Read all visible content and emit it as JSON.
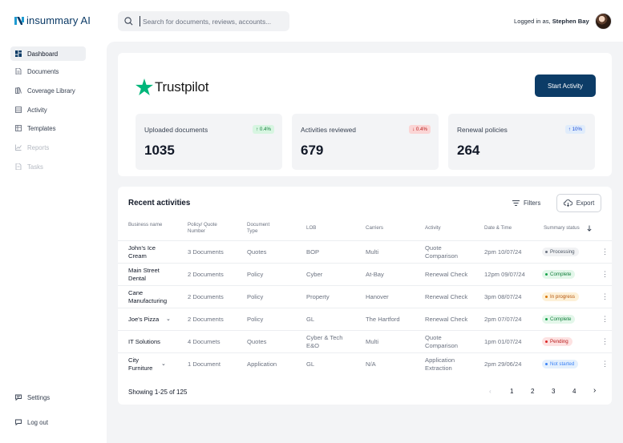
{
  "app": {
    "logo_text": "insummary AI"
  },
  "search": {
    "placeholder": "Search for documents, reviews, accounts..."
  },
  "user": {
    "prefix": "Logged in as,",
    "name": "Stephen Bay"
  },
  "sidebar": {
    "items": [
      {
        "label": "Dashboard",
        "icon": "dashboard-icon",
        "active": true
      },
      {
        "label": "Documents",
        "icon": "document-icon"
      },
      {
        "label": "Coverage Library",
        "icon": "library-icon"
      },
      {
        "label": "Activity",
        "icon": "activity-icon"
      },
      {
        "label": "Templates",
        "icon": "templates-icon"
      },
      {
        "label": "Reports",
        "icon": "reports-icon",
        "disabled": true
      },
      {
        "label": "Tasks",
        "icon": "tasks-icon",
        "disabled": true
      }
    ],
    "bottom": [
      {
        "label": "Settings",
        "icon": "settings-icon"
      },
      {
        "label": "Log out",
        "icon": "logout-icon"
      }
    ]
  },
  "brand": {
    "name": "Trustpilot"
  },
  "header": {
    "start_label": "Start Activity"
  },
  "stats": [
    {
      "label": "Uploaded documents",
      "value": "1035",
      "badge": "↑ 0.4%",
      "trend": "up"
    },
    {
      "label": "Activities reviewed",
      "value": "679",
      "badge": "↓ 0.4%",
      "trend": "down"
    },
    {
      "label": "Renewal policies",
      "value": "264",
      "badge": "↑ 10%",
      "trend": "info"
    }
  ],
  "table": {
    "title": "Recent activities",
    "filters_label": "Filters",
    "export_label": "Export",
    "columns": [
      "Business name",
      "Policy/ Quote Number",
      "Document Type",
      "LOB",
      "Carriers",
      "Activity",
      "Date & Time",
      "Summary status"
    ],
    "rows": [
      {
        "business": "John's Ice Cream",
        "policy": "3 Documents",
        "doc_type": "Quotes",
        "lob": "BOP",
        "carrier": "Multi",
        "activity": "Quote Comparison",
        "date": "2pm 10/07/24",
        "status": "Processing"
      },
      {
        "business": "Main Street Dental",
        "policy": "2 Documents",
        "doc_type": "Policy",
        "lob": "Cyber",
        "carrier": "At-Bay",
        "activity": "Renewal Check",
        "date": "12pm 09/07/24",
        "status": "Complete"
      },
      {
        "business": "Cane Manufacturing",
        "policy": "2 Documents",
        "doc_type": "Policy",
        "lob": "Property",
        "carrier": "Hanover",
        "activity": "Renewal Check",
        "date": "3pm 08/07/24",
        "status": "In progress"
      },
      {
        "business": "Joe's Pizza",
        "policy": "2 Documents",
        "doc_type": "Policy",
        "lob": "GL",
        "carrier": "The Hartford",
        "activity": "Renewal Check",
        "date": "2pm 07/07/24",
        "status": "Complete"
      },
      {
        "business": "IT Solutions",
        "policy": "4 Documets",
        "doc_type": "Quotes",
        "lob": "Cyber & Tech E&O",
        "carrier": "Multi",
        "activity": "Quote Comparison",
        "date": "1pm 01/07/24",
        "status": "Pending"
      },
      {
        "business": "City Furniture",
        "policy": "1 Document",
        "doc_type": "Application",
        "lob": "GL",
        "carrier": "N/A",
        "activity": "Application Extraction",
        "date": "2pm 29/06/24",
        "status": "Not started"
      }
    ],
    "showing": "Showing 1-25 of 125",
    "pages": [
      "1",
      "2",
      "3",
      "4"
    ]
  },
  "colors": {
    "brand": "#0c3c67",
    "trustpilot_star": "#00b67a",
    "complete": "#16a34a",
    "pending": "#dc2626",
    "in_progress": "#d97706",
    "processing": "#6b7280",
    "not_started": "#3b82f6"
  }
}
